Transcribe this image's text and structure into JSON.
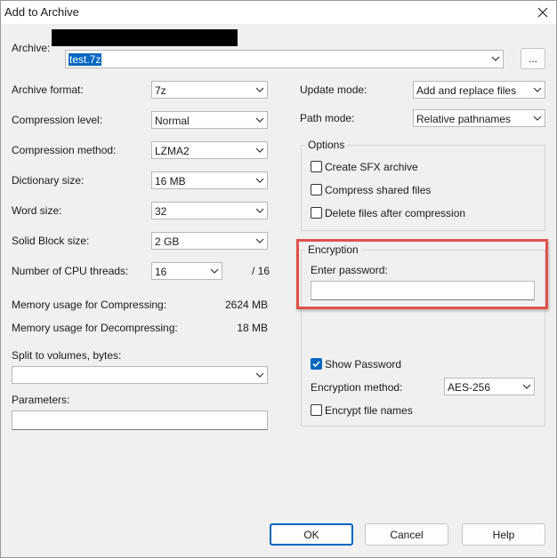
{
  "window": {
    "title": "Add to Archive"
  },
  "archive": {
    "label": "Archive:",
    "path_value": "test.7z",
    "browse_label": "..."
  },
  "left": {
    "archive_format": {
      "label": "Archive format:",
      "value": "7z"
    },
    "compression_level": {
      "label": "Compression level:",
      "value": "Normal"
    },
    "compression_method": {
      "label": "Compression method:",
      "value": "LZMA2"
    },
    "dictionary_size": {
      "label": "Dictionary size:",
      "value": "16 MB"
    },
    "word_size": {
      "label": "Word size:",
      "value": "32"
    },
    "solid_block_size": {
      "label": "Solid Block size:",
      "value": "2 GB"
    },
    "cpu_threads": {
      "label": "Number of CPU threads:",
      "value": "16",
      "max": "/ 16"
    },
    "memory_compress": {
      "label": "Memory usage for Compressing:",
      "value": "2624 MB"
    },
    "memory_decompress": {
      "label": "Memory usage for Decompressing:",
      "value": "18 MB"
    },
    "split_volumes": {
      "label": "Split to volumes, bytes:",
      "value": ""
    },
    "parameters": {
      "label": "Parameters:",
      "value": ""
    }
  },
  "right": {
    "update_mode": {
      "label": "Update mode:",
      "value": "Add and replace files"
    },
    "path_mode": {
      "label": "Path mode:",
      "value": "Relative pathnames"
    },
    "options": {
      "title": "Options",
      "create_sfx": {
        "label": "Create SFX archive",
        "checked": false
      },
      "compress_shared": {
        "label": "Compress shared files",
        "checked": false
      },
      "delete_after": {
        "label": "Delete files after compression",
        "checked": false
      }
    },
    "encryption": {
      "title": "Encryption",
      "password_label": "Enter password:",
      "password_value": "",
      "show_password": {
        "label": "Show Password",
        "checked": true
      },
      "method": {
        "label": "Encryption method:",
        "value": "AES-256"
      },
      "encrypt_names": {
        "label": "Encrypt file names",
        "checked": false
      }
    },
    "highlight_color": "#e0524a"
  },
  "buttons": {
    "ok": "OK",
    "cancel": "Cancel",
    "help": "Help"
  },
  "colors": {
    "accent": "#0067c0",
    "dialog_bg": "#f0f0f0"
  },
  "redacted_bar_color": "#000000"
}
